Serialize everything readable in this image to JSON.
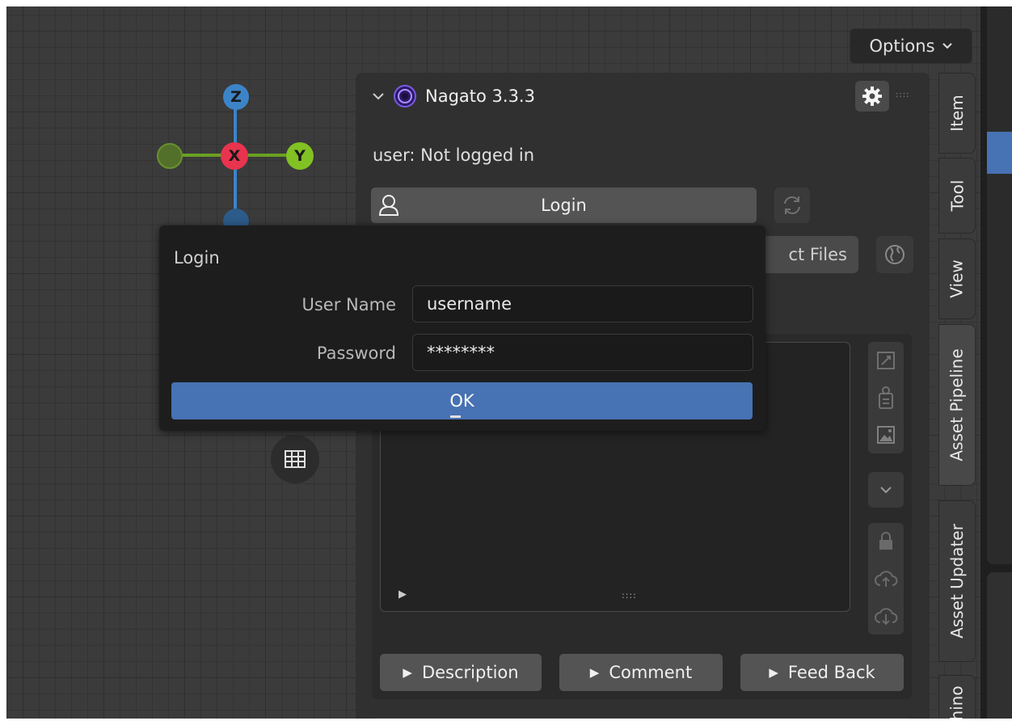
{
  "viewport": {
    "options_label": "Options",
    "gizmo": {
      "z": "Z",
      "x": "X",
      "y": "Y"
    }
  },
  "panel": {
    "title": "Nagato 3.3.3",
    "user_status": "user: Not logged in",
    "login_label": "Login",
    "select_files_label": "ct Files",
    "buttons": {
      "description": "Description",
      "comment": "Comment",
      "feedback": "Feed Back"
    },
    "text_area_grip": "::::"
  },
  "tabs": [
    "Item",
    "Tool",
    "View",
    "Asset Pipeline",
    "Asset Updater",
    "hino"
  ],
  "dialog": {
    "title": "Login",
    "username_label": "User Name",
    "username_value": "username",
    "password_label": "Password",
    "password_value": "********",
    "ok_label": "OK"
  },
  "colors": {
    "accent_blue": "#4772b3",
    "axis_x": "#e8344f",
    "axis_y": "#82c123",
    "axis_z": "#3c84c8"
  },
  "icons": [
    "chevron-down-icon",
    "nagato-logo-icon",
    "gear-icon",
    "user-icon",
    "refresh-icon",
    "globe-icon",
    "rocket-icon",
    "clipboard-icon",
    "image-icon",
    "lock-icon",
    "cloud-upload-icon",
    "cloud-download-icon",
    "play-icon",
    "grid-icon"
  ]
}
